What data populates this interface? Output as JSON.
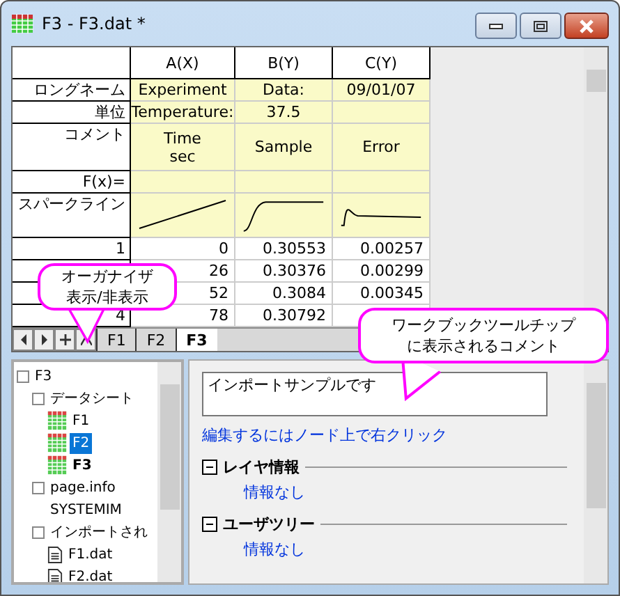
{
  "window": {
    "title": "F3 - F3.dat *"
  },
  "table": {
    "columns": [
      "A(X)",
      "B(Y)",
      "C(Y)"
    ],
    "label_rows": [
      {
        "label": "ロングネーム",
        "cells": [
          "Experiment",
          "Data:",
          "09/01/07"
        ]
      },
      {
        "label": "単位",
        "cells": [
          "Temperature:",
          "37.5",
          null
        ]
      },
      {
        "label": "コメント",
        "cells": [
          "Time\nsec",
          "Sample",
          "Error"
        ]
      },
      {
        "label": "F(x)=",
        "cells": [
          null,
          null,
          null
        ]
      }
    ],
    "sparklines": {
      "label": "スパークライン",
      "cells": [
        {
          "kind": "linear"
        },
        {
          "kind": "sigmoid"
        },
        {
          "kind": "peak"
        }
      ]
    },
    "rows": [
      {
        "label": "1",
        "cells": [
          "0",
          "0.30553",
          "0.00257"
        ]
      },
      {
        "cells": [
          "26",
          "0.30376",
          "0.00299"
        ]
      },
      {
        "cells": [
          "52",
          "0.3084",
          "0.00345"
        ]
      },
      {
        "label": "4",
        "cells": [
          "78",
          "0.30792",
          null
        ]
      }
    ]
  },
  "sheet_tabs": [
    {
      "label": "F1",
      "selected": false
    },
    {
      "label": "F2",
      "selected": false
    },
    {
      "label": "F3",
      "selected": true
    }
  ],
  "tree": [
    {
      "label": "F3",
      "kind": "folder",
      "selected": false,
      "children": [
        {
          "label": "データシート",
          "kind": "folder",
          "selected": false,
          "children": [
            {
              "label": "F1",
              "kind": "sheet",
              "selected": false,
              "active": false
            },
            {
              "label": "F2",
              "kind": "sheet",
              "selected": true,
              "active": false
            },
            {
              "label": "F3",
              "kind": "sheet",
              "selected": false,
              "active": true
            }
          ]
        },
        {
          "label": "page.info",
          "kind": "folder",
          "selected": false,
          "children": [
            {
              "label": "SYSTEMIM",
              "kind": "plain",
              "selected": false
            }
          ]
        },
        {
          "label": "インポートされ",
          "kind": "folder",
          "selected": false,
          "children": [
            {
              "label": "F1.dat",
              "kind": "file",
              "selected": false
            },
            {
              "label": "F2.dat",
              "kind": "file",
              "selected": false
            }
          ]
        }
      ]
    }
  ],
  "details": {
    "comment": "インポートサンプルです",
    "hint_link": "編集するにはノード上で右クリック",
    "sections": [
      {
        "title": "レイヤ情報",
        "expanded": true,
        "value": "情報なし"
      },
      {
        "title": "ユーザツリー",
        "expanded": true,
        "value": "情報なし"
      }
    ]
  },
  "callouts": [
    {
      "lines": [
        "オーガナイザ",
        "表示/非表示"
      ],
      "kind": "left"
    },
    {
      "lines": [
        "ワークブックツールチップ",
        "に表示されるコメント"
      ],
      "kind": "right"
    }
  ]
}
